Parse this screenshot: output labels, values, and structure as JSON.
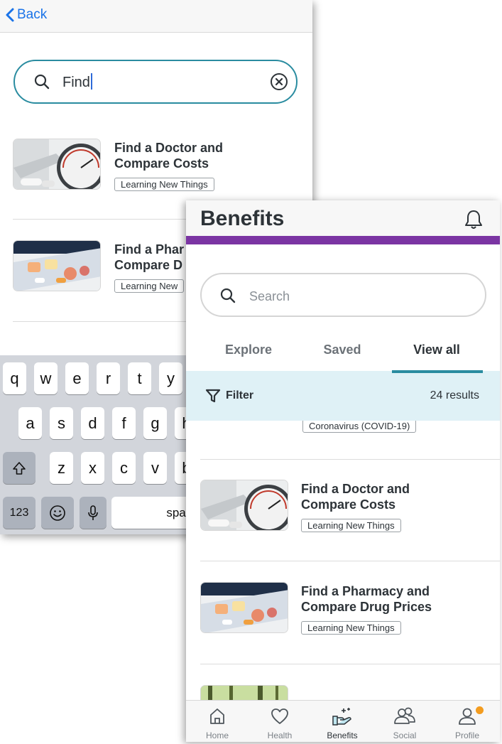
{
  "back_screen": {
    "back_label": "Back",
    "search_value": "Find",
    "results": [
      {
        "title_line1": "Find a Doctor and",
        "title_line2": "Compare Costs",
        "tag": "Learning New Things"
      },
      {
        "title_line1": "Find a Phar",
        "title_line2": "Compare D",
        "tag": "Learning New"
      }
    ],
    "keyboard": {
      "row1": [
        "q",
        "w",
        "e",
        "r",
        "t",
        "y"
      ],
      "row2": [
        "a",
        "s",
        "d",
        "f",
        "g",
        "h"
      ],
      "row3": [
        "z",
        "x",
        "c",
        "v",
        "b"
      ],
      "numbers_key": "123",
      "space_key": "space"
    }
  },
  "front_screen": {
    "title": "Benefits",
    "search_placeholder": "Search",
    "tabs": [
      {
        "label": "Explore",
        "active": false
      },
      {
        "label": "Saved",
        "active": false
      },
      {
        "label": "View all",
        "active": true
      }
    ],
    "filter_label": "Filter",
    "results_count": "24 results",
    "partial_tag": "Coronavirus (COVID-19)",
    "results": [
      {
        "title_line1": "Find a Doctor and",
        "title_line2": "Compare Costs",
        "tag": "Learning New Things"
      },
      {
        "title_line1": "Find a Pharmacy and",
        "title_line2": "Compare Drug Prices",
        "tag": "Learning New Things"
      }
    ],
    "bottom_nav": [
      {
        "label": "Home",
        "icon": "home-icon",
        "active": false
      },
      {
        "label": "Health",
        "icon": "heart-icon",
        "active": false
      },
      {
        "label": "Benefits",
        "icon": "benefits-hand-icon",
        "active": true
      },
      {
        "label": "Social",
        "icon": "people-icon",
        "active": false
      },
      {
        "label": "Profile",
        "icon": "person-icon",
        "active": false,
        "notification_dot": true
      }
    ]
  },
  "colors": {
    "accent_teal": "#2a8ca0",
    "brand_purple": "#7b35a3",
    "filter_background": "#dff1f6",
    "notification_orange": "#f39c1f",
    "back_link_blue": "#1a73e8"
  }
}
